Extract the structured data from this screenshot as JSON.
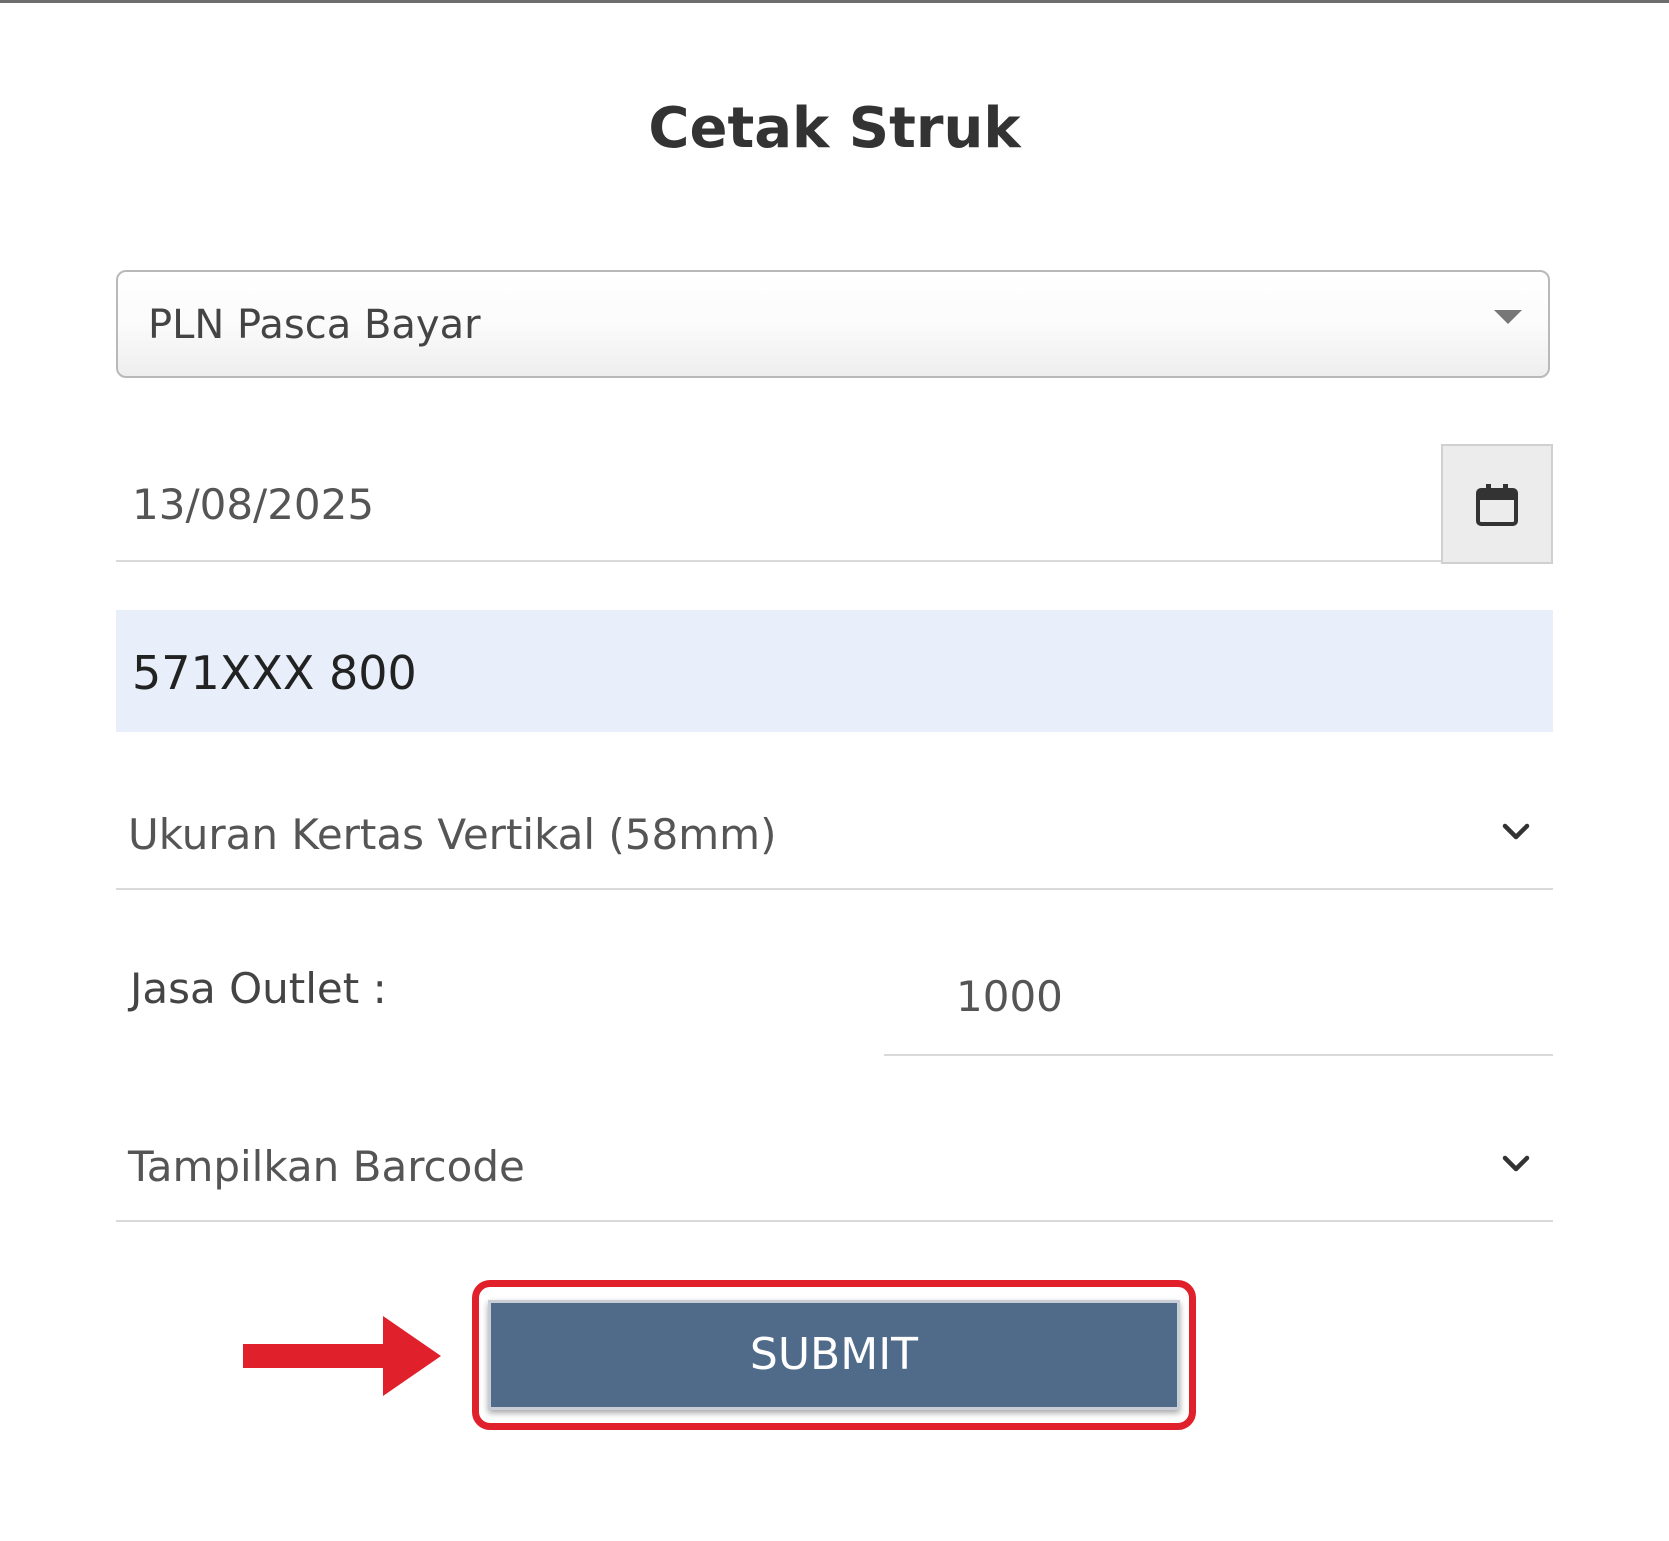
{
  "page": {
    "title": "Cetak Struk"
  },
  "form": {
    "product_select": {
      "value": "PLN Pasca Bayar"
    },
    "date_field": {
      "value": "13/08/2025",
      "icon": "calendar-icon"
    },
    "customer_id_field": {
      "value": "571XXX 800"
    },
    "paper_size_select": {
      "value": "Ukuran Kertas Vertikal (58mm)",
      "icon": "chevron-down-icon"
    },
    "outlet_fee": {
      "label": "Jasa Outlet :",
      "value": "1000"
    },
    "barcode_select": {
      "value": "Tampilkan Barcode",
      "icon": "chevron-down-icon"
    },
    "submit": {
      "label": "SUBMIT"
    }
  },
  "annotation": {
    "color": "#e0202a",
    "arrow_icon": "arrow-right-icon",
    "highlight_target": "submit-button"
  },
  "colors": {
    "submit_bg": "#506a8a",
    "autofill_bg": "#e8effb"
  }
}
